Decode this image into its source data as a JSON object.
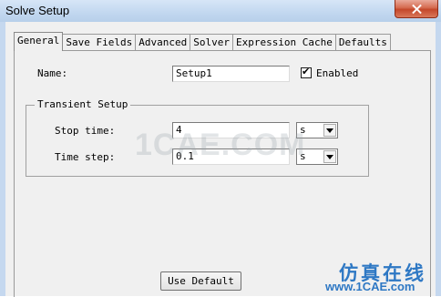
{
  "window": {
    "title": "Solve Setup"
  },
  "tabs": [
    "General",
    "Save Fields",
    "Advanced",
    "Solver",
    "Expression Cache",
    "Defaults"
  ],
  "active_tab": "General",
  "general": {
    "name_label": "Name:",
    "name_value": "Setup1",
    "enabled_checked": true,
    "enabled_label": "Enabled",
    "transient": {
      "title": "Transient Setup",
      "stop_time_label": "Stop time:",
      "stop_time_value": "4",
      "stop_time_unit": "s",
      "time_step_label": "Time step:",
      "time_step_value": "0.1",
      "time_step_unit": "s"
    },
    "use_default_label": "Use Default"
  },
  "watermark": {
    "center_text": "1CAE.COM",
    "logo_cn": "仿真在线",
    "logo_url": "www.1CAE.com"
  }
}
